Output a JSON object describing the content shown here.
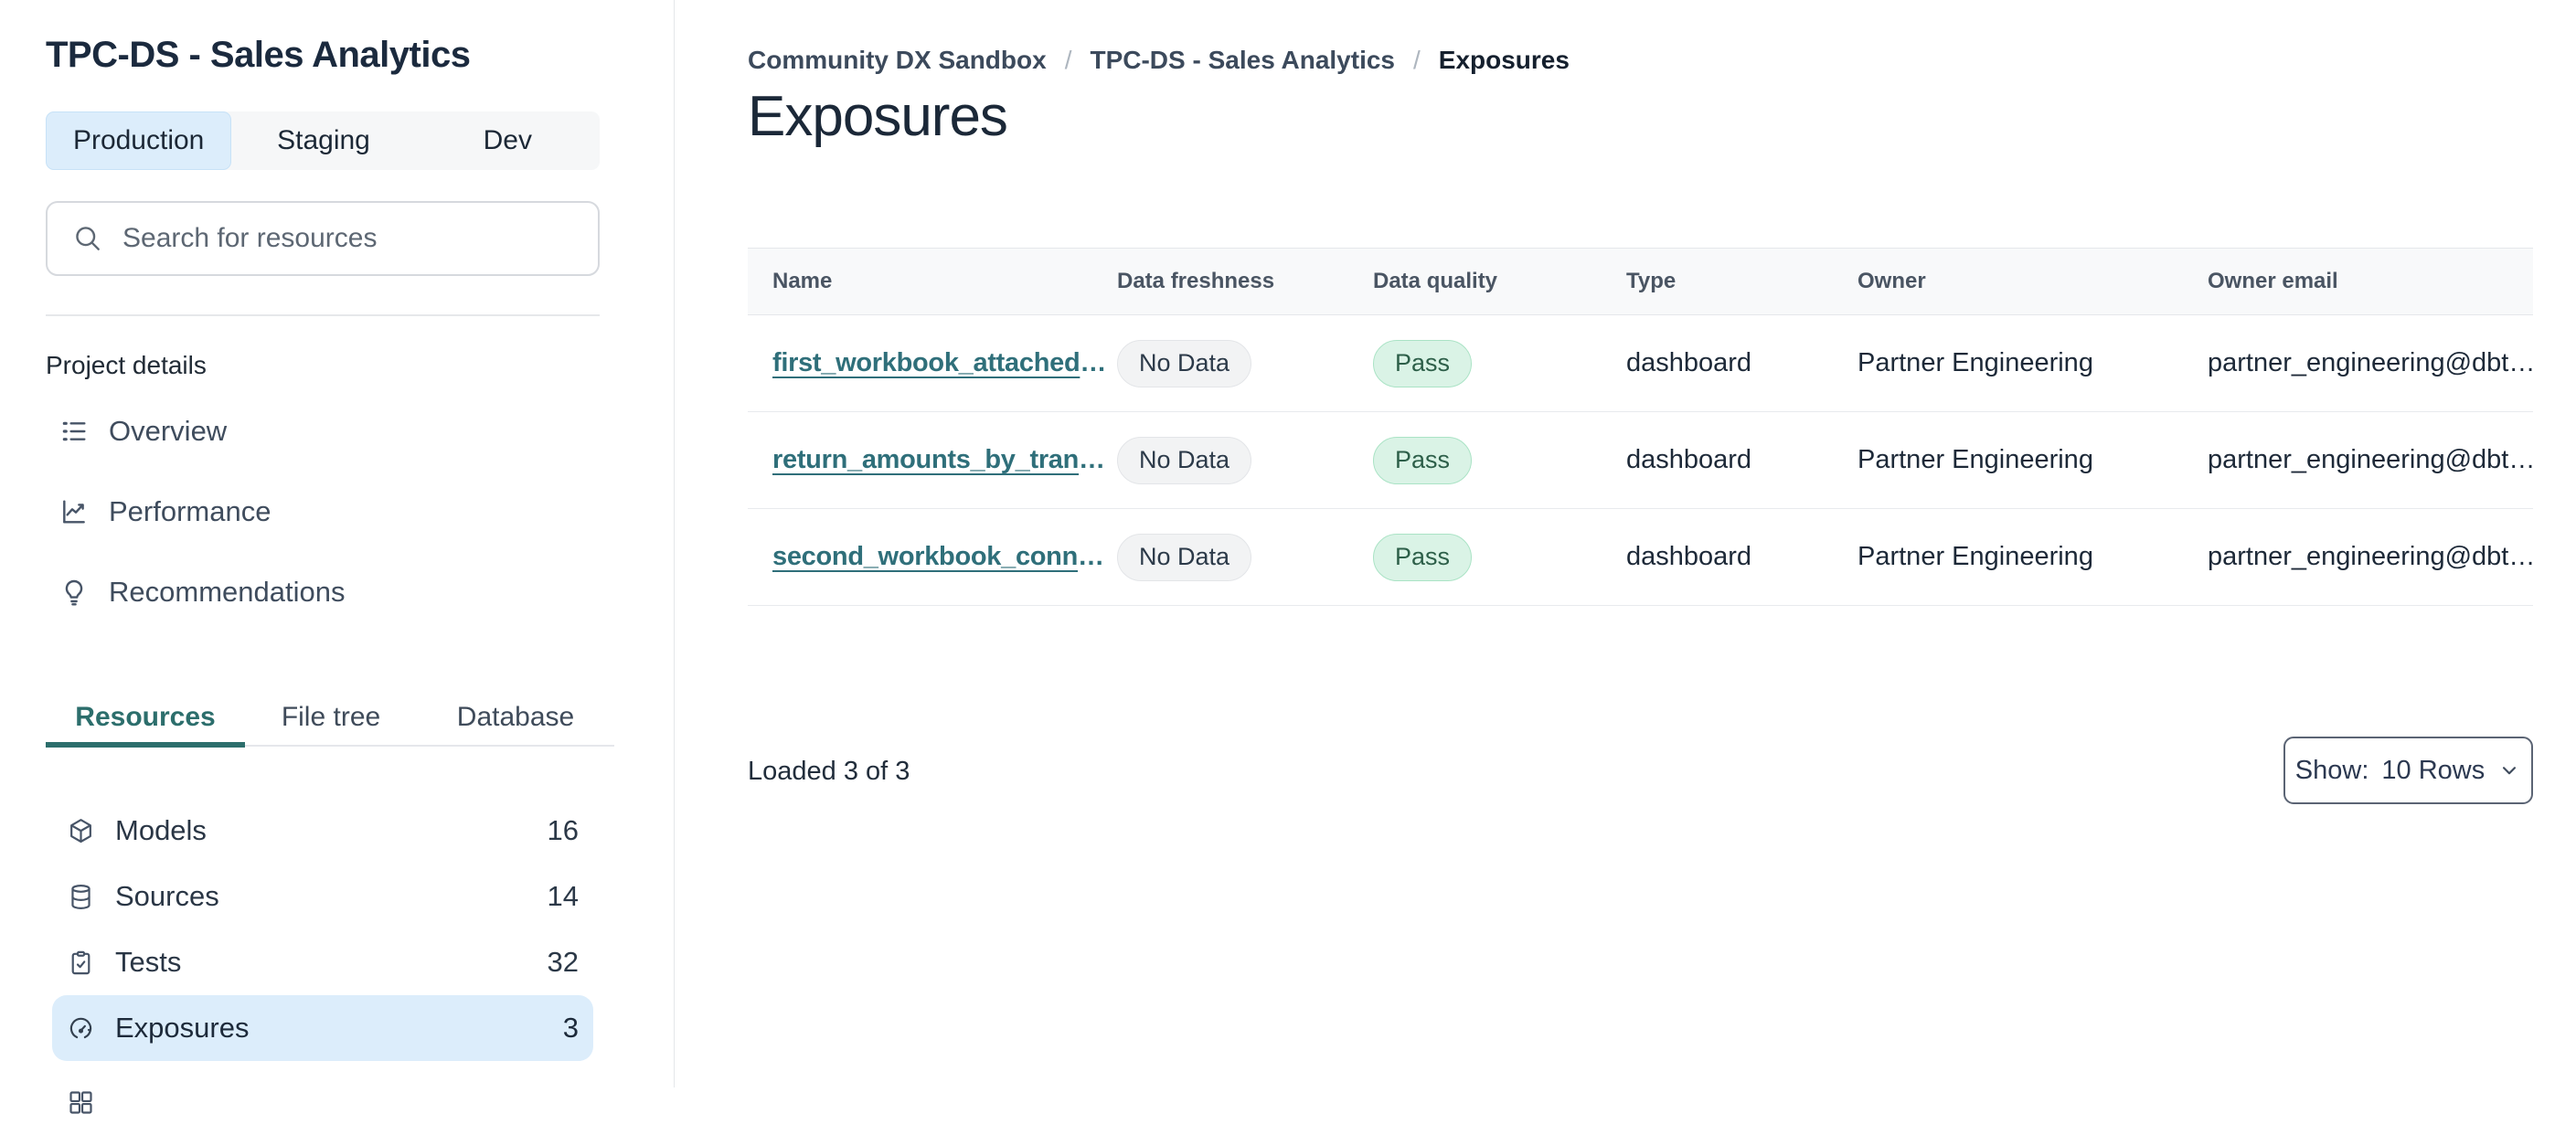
{
  "sidebar": {
    "project_title": "TPC-DS - Sales Analytics",
    "env_tabs": [
      {
        "label": "Production",
        "active": true
      },
      {
        "label": "Staging",
        "active": false
      },
      {
        "label": "Dev",
        "active": false
      }
    ],
    "search": {
      "placeholder": "Search for resources"
    },
    "section_label": "Project details",
    "nav_items": [
      {
        "label": "Overview",
        "icon": "list-icon"
      },
      {
        "label": "Performance",
        "icon": "chart-trend-icon"
      },
      {
        "label": "Recommendations",
        "icon": "lightbulb-icon"
      }
    ],
    "resource_tabs": [
      {
        "label": "Resources",
        "active": true
      },
      {
        "label": "File tree",
        "active": false
      },
      {
        "label": "Database",
        "active": false
      }
    ],
    "resource_items": [
      {
        "label": "Models",
        "count": "16",
        "icon": "cube-icon",
        "active": false
      },
      {
        "label": "Sources",
        "count": "14",
        "icon": "database-icon",
        "active": false
      },
      {
        "label": "Tests",
        "count": "32",
        "icon": "clipboard-check-icon",
        "active": false
      },
      {
        "label": "Exposures",
        "count": "3",
        "icon": "gauge-icon",
        "active": true
      }
    ]
  },
  "main": {
    "breadcrumb": {
      "separator": "/",
      "items": [
        {
          "label": "Community DX Sandbox"
        },
        {
          "label": "TPC-DS - Sales Analytics"
        },
        {
          "label": "Exposures"
        }
      ]
    },
    "page_title": "Exposures",
    "table": {
      "columns": [
        "Name",
        "Data freshness",
        "Data quality",
        "Type",
        "Owner",
        "Owner email"
      ],
      "rows": [
        {
          "name": "first_workbook_attached",
          "name_suffix": "…",
          "freshness": "No Data",
          "quality": "Pass",
          "type": "dashboard",
          "owner": "Partner Engineering",
          "owner_email": "partner_engineering@dbt…"
        },
        {
          "name": "return_amounts_by_tran",
          "name_suffix": "…",
          "freshness": "No Data",
          "quality": "Pass",
          "type": "dashboard",
          "owner": "Partner Engineering",
          "owner_email": "partner_engineering@dbt…"
        },
        {
          "name": "second_workbook_conn",
          "name_suffix": "…",
          "freshness": "No Data",
          "quality": "Pass",
          "type": "dashboard",
          "owner": "Partner Engineering",
          "owner_email": "partner_engineering@dbt…"
        }
      ]
    },
    "footer": {
      "loaded_text": "Loaded 3 of 3",
      "show_label": "Show:",
      "show_value": "10 Rows"
    }
  },
  "colors": {
    "accent_teal": "#2c6e6c",
    "link_teal": "#2f6f7a",
    "active_item_bg": "#dcedfb",
    "pass_bg": "#daf3e6",
    "pass_border": "#aae3c5",
    "pass_text": "#2d5f49",
    "nodata_bg": "#f2f3f4",
    "header_bg": "#f8f9fa",
    "text_dark": "#1b2838"
  }
}
